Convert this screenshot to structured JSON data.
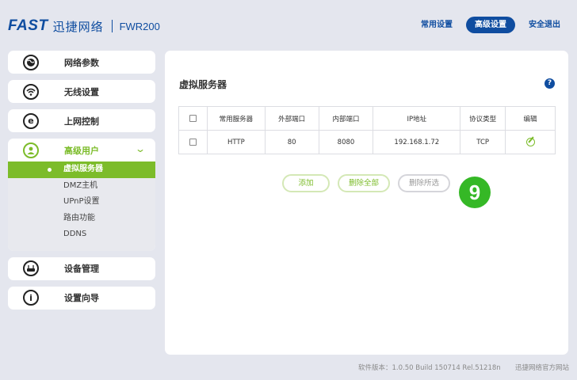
{
  "header": {
    "logo_brand": "FAST",
    "logo_cn": "迅捷网络",
    "model": "FWR200",
    "nav": [
      {
        "label": "常用设置"
      },
      {
        "label": "高级设置"
      },
      {
        "label": "安全退出"
      }
    ]
  },
  "sidebar": {
    "items": [
      {
        "label": "网络参数",
        "icon": "globe-icon"
      },
      {
        "label": "无线设置",
        "icon": "wifi-icon"
      },
      {
        "label": "上网控制",
        "icon": "e-icon"
      }
    ],
    "group": {
      "label": "高级用户",
      "icon": "user-icon",
      "sub_items": [
        {
          "label": "虚拟服务器"
        },
        {
          "label": "DMZ主机"
        },
        {
          "label": "UPnP设置"
        },
        {
          "label": "路由功能"
        },
        {
          "label": "DDNS"
        }
      ]
    },
    "bottom_items": [
      {
        "label": "设备管理",
        "icon": "router-icon"
      },
      {
        "label": "设置向导",
        "icon": "info-icon"
      }
    ]
  },
  "main": {
    "title": "虚拟服务器",
    "help": "?",
    "table": {
      "headers": [
        "常用服务器",
        "外部端口",
        "内部端口",
        "IP地址",
        "协议类型",
        "编辑"
      ],
      "rows": [
        [
          "HTTP",
          "80",
          "8080",
          "192.168.1.72",
          "TCP"
        ]
      ]
    },
    "buttons": {
      "add": "添加",
      "delete_all": "删除全部",
      "delete_selected": "删除所选"
    },
    "step_badge": "9"
  },
  "footer": {
    "version": "软件版本：1.0.50 Build 150714 Rel.51218n",
    "site": "迅捷网络官方网站"
  },
  "colors": {
    "brand_blue": "#0f4da0",
    "accent_green": "#7cbc2a",
    "badge_green": "#35b826",
    "background": "#e4e6ee"
  }
}
